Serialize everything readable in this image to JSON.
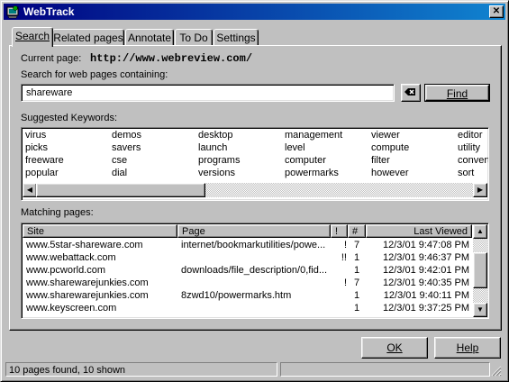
{
  "window": {
    "title": "WebTrack",
    "close_glyph": "✕"
  },
  "tabs": [
    {
      "label": "Search",
      "active": true
    },
    {
      "label": "Related pages",
      "active": false
    },
    {
      "label": "Annotate",
      "active": false
    },
    {
      "label": "To Do",
      "active": false
    },
    {
      "label": "Settings",
      "active": false
    }
  ],
  "search": {
    "current_page_label": "Current page:",
    "current_page_url": "http://www.webreview.com/",
    "prompt": "Search for web pages containing:",
    "query": "shareware",
    "find_label": "Find"
  },
  "keywords": {
    "label": "Suggested Keywords:",
    "items": [
      "virus",
      "demos",
      "desktop",
      "management",
      "viewer",
      "editor",
      "picks",
      "savers",
      "launch",
      "level",
      "compute",
      "utility",
      "freeware",
      "cse",
      "programs",
      "computer",
      "filter",
      "convert",
      "popular",
      "dial",
      "versions",
      "powermarks",
      "however",
      "sort"
    ]
  },
  "matches": {
    "label": "Matching pages:",
    "columns": {
      "site": "Site",
      "page": "Page",
      "flag": "!",
      "count": "#",
      "last_viewed": "Last Viewed"
    },
    "rows": [
      {
        "site": "www.5star-shareware.com",
        "page": "internet/bookmarkutilities/powe...",
        "flag": "!",
        "count": "7",
        "last_viewed": "12/3/01 9:47:08 PM"
      },
      {
        "site": "www.webattack.com",
        "page": "",
        "flag": "!!",
        "count": "1",
        "last_viewed": "12/3/01 9:46:37 PM"
      },
      {
        "site": "www.pcworld.com",
        "page": "downloads/file_description/0,fid...",
        "flag": "",
        "count": "1",
        "last_viewed": "12/3/01 9:42:01 PM"
      },
      {
        "site": "www.sharewarejunkies.com",
        "page": "",
        "flag": "!",
        "count": "7",
        "last_viewed": "12/3/01 9:40:35 PM"
      },
      {
        "site": "www.sharewarejunkies.com",
        "page": "8zwd10/powermarks.htm",
        "flag": "",
        "count": "1",
        "last_viewed": "12/3/01 9:40:11 PM"
      },
      {
        "site": "www.keyscreen.com",
        "page": "",
        "flag": "",
        "count": "1",
        "last_viewed": "12/3/01 9:37:25 PM"
      }
    ]
  },
  "buttons": {
    "ok": "OK",
    "help": "Help"
  },
  "status": {
    "left": "10 pages found, 10 shown",
    "right": ""
  }
}
